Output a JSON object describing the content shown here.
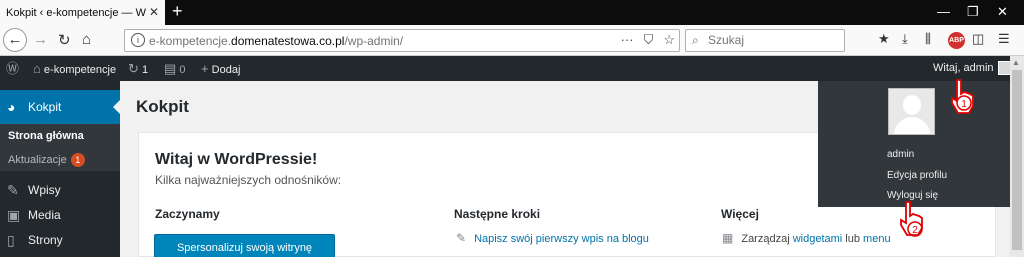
{
  "browser": {
    "tab_title": "Kokpit ‹ e-kompetencje — WordPress",
    "url_prefix": "e-kompetencje.",
    "url_domain": "domenatestowa.co.pl",
    "url_path": "/wp-admin/",
    "url_more": "···",
    "search_placeholder": "Szukaj",
    "abp_label": "ABP"
  },
  "adminbar": {
    "site_name": "e-kompetencje",
    "updates_count": "1",
    "comments_count": "0",
    "new_label": "Dodaj",
    "greeting": "Witaj, admin"
  },
  "sidebar": {
    "current": "Kokpit",
    "submenu_home": "Strona główna",
    "submenu_updates": "Aktualizacje",
    "updates_badge": "1",
    "items": [
      {
        "label": "Wpisy"
      },
      {
        "label": "Media"
      },
      {
        "label": "Strony"
      }
    ]
  },
  "main": {
    "page_title": "Kokpit",
    "welcome_title": "Witaj w WordPressie!",
    "welcome_subtitle": "Kilka najważniejszych odnośników:",
    "col1_title": "Zaczynamy",
    "col1_button": "Spersonalizuj swoją witrynę",
    "col2_title": "Następne kroki",
    "col2_link": "Napisz swój pierwszy wpis na blogu",
    "col3_title": "Więcej",
    "col3_prefix": "Zarządzaj",
    "col3_link1": "widgetami",
    "col3_mid": "lub",
    "col3_link2": "menu"
  },
  "dropdown": {
    "username": "admin",
    "edit_profile": "Edycja profilu",
    "logout": "Wyloguj się"
  },
  "annotations": {
    "step1": "1",
    "step2": "2",
    "color": "#e00000"
  },
  "colors": {
    "wp_admin_bar": "#23282d",
    "wp_accent": "#0073aa",
    "wp_button": "#0085ba",
    "badge": "#d54e21"
  }
}
